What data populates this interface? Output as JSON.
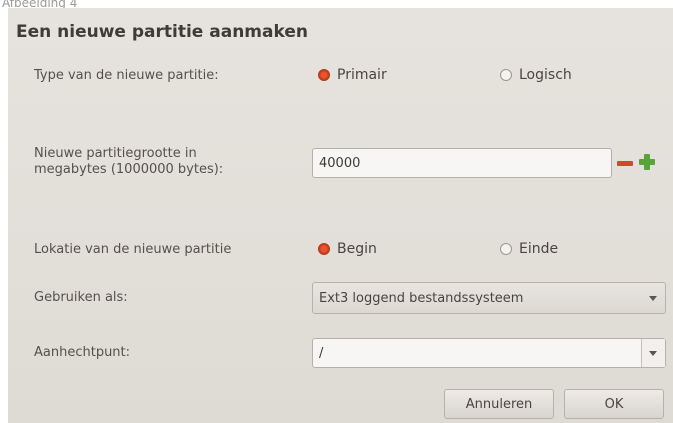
{
  "caption": "Afbeelding 4",
  "dialog": {
    "title": "Een nieuwe partitie aanmaken",
    "type_label": "Type van de nieuwe partitie:",
    "type_options": [
      {
        "label": "Primair",
        "checked": true
      },
      {
        "label": "Logisch",
        "checked": false
      }
    ],
    "size_label_line1": "Nieuwe partitiegrootte in",
    "size_label_line2": "megabytes (1000000 bytes):",
    "size_value": "40000",
    "location_label": "Lokatie van de nieuwe partitie",
    "location_options": [
      {
        "label": "Begin",
        "checked": true
      },
      {
        "label": "Einde",
        "checked": false
      }
    ],
    "use_as_label": "Gebruiken als:",
    "use_as_value": "Ext3 loggend bestandssysteem",
    "mount_label": "Aanhechtpunt:",
    "mount_value": "/",
    "cancel_label": "Annuleren",
    "ok_label": "OK"
  },
  "colors": {
    "radio_checked": "#e8542c",
    "minus": "#d8452d",
    "plus": "#58a43a"
  }
}
